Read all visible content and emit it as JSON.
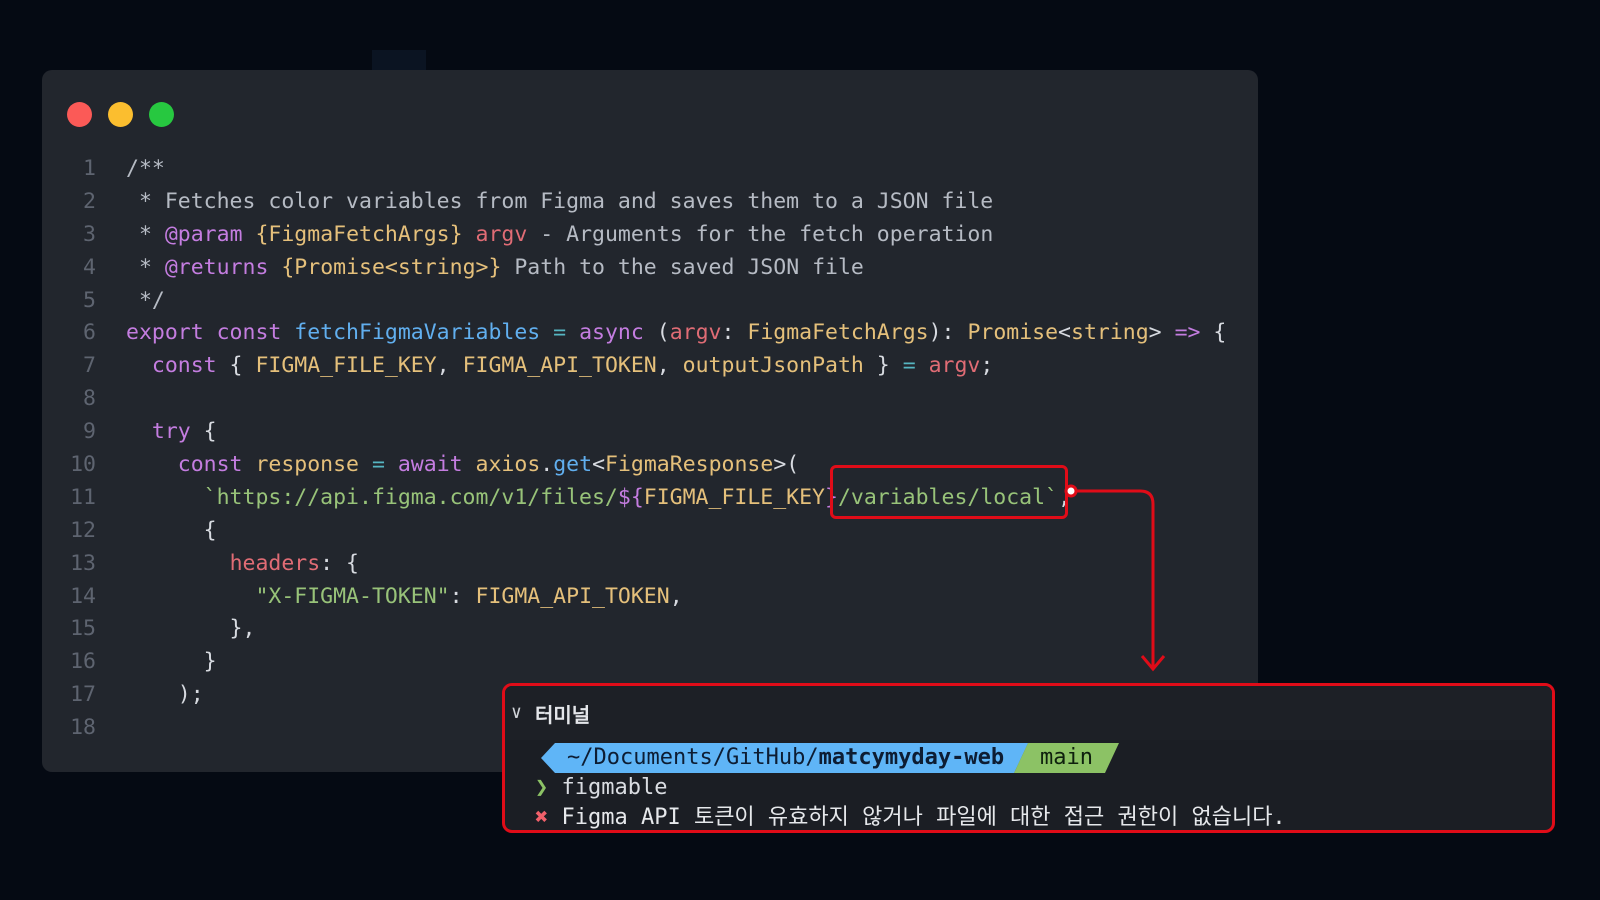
{
  "window": {
    "dots": [
      {
        "name": "close-dot",
        "color": "#fb5a57"
      },
      {
        "name": "minimize-dot",
        "color": "#fbbe2f"
      },
      {
        "name": "maximize-dot",
        "color": "#27c840"
      }
    ]
  },
  "colors": {
    "comment": "#b6bbc4",
    "keyword": "#c47de0",
    "function": "#61afef",
    "type": "#e5c07b",
    "variable": "#e06c75",
    "string": "#98c379",
    "plain": "#d7dae0",
    "operator": "#56b6c2",
    "highlight": "#e00c18"
  },
  "code": {
    "lines": [
      {
        "n": "1",
        "tokens": [
          {
            "t": "/**",
            "c": "comment"
          }
        ]
      },
      {
        "n": "2",
        "tokens": [
          {
            "t": " * Fetches color variables from Figma and saves them to a JSON file",
            "c": "comment"
          }
        ]
      },
      {
        "n": "3",
        "tokens": [
          {
            "t": " * ",
            "c": "comment"
          },
          {
            "t": "@param",
            "c": "keyword"
          },
          {
            "t": " ",
            "c": "comment"
          },
          {
            "t": "{FigmaFetchArgs}",
            "c": "type"
          },
          {
            "t": " ",
            "c": "comment"
          },
          {
            "t": "argv",
            "c": "variable"
          },
          {
            "t": " - Arguments for the fetch operation",
            "c": "comment"
          }
        ]
      },
      {
        "n": "4",
        "tokens": [
          {
            "t": " * ",
            "c": "comment"
          },
          {
            "t": "@returns",
            "c": "keyword"
          },
          {
            "t": " ",
            "c": "comment"
          },
          {
            "t": "{Promise<string>}",
            "c": "type"
          },
          {
            "t": " Path to the saved JSON file",
            "c": "comment"
          }
        ]
      },
      {
        "n": "5",
        "tokens": [
          {
            "t": " */",
            "c": "comment"
          }
        ]
      },
      {
        "n": "6",
        "tokens": [
          {
            "t": "export const ",
            "c": "keyword"
          },
          {
            "t": "fetchFigmaVariables",
            "c": "function"
          },
          {
            "t": " = ",
            "c": "operator"
          },
          {
            "t": "async",
            "c": "keyword"
          },
          {
            "t": " (",
            "c": "plain"
          },
          {
            "t": "argv",
            "c": "variable"
          },
          {
            "t": ": ",
            "c": "plain"
          },
          {
            "t": "FigmaFetchArgs",
            "c": "type"
          },
          {
            "t": "): ",
            "c": "plain"
          },
          {
            "t": "Promise",
            "c": "type"
          },
          {
            "t": "<",
            "c": "plain"
          },
          {
            "t": "string",
            "c": "type"
          },
          {
            "t": "> ",
            "c": "plain"
          },
          {
            "t": "=>",
            "c": "keyword"
          },
          {
            "t": " {",
            "c": "plain"
          }
        ]
      },
      {
        "n": "7",
        "tokens": [
          {
            "t": "  const",
            "c": "keyword"
          },
          {
            "t": " { ",
            "c": "plain"
          },
          {
            "t": "FIGMA_FILE_KEY",
            "c": "type"
          },
          {
            "t": ", ",
            "c": "plain"
          },
          {
            "t": "FIGMA_API_TOKEN",
            "c": "type"
          },
          {
            "t": ", ",
            "c": "plain"
          },
          {
            "t": "outputJsonPath",
            "c": "type"
          },
          {
            "t": " } ",
            "c": "plain"
          },
          {
            "t": "=",
            "c": "operator"
          },
          {
            "t": " ",
            "c": "plain"
          },
          {
            "t": "argv",
            "c": "variable"
          },
          {
            "t": ";",
            "c": "plain"
          }
        ]
      },
      {
        "n": "8",
        "tokens": []
      },
      {
        "n": "9",
        "tokens": [
          {
            "t": "  try",
            "c": "keyword"
          },
          {
            "t": " {",
            "c": "plain"
          }
        ]
      },
      {
        "n": "10",
        "tokens": [
          {
            "t": "    const",
            "c": "keyword"
          },
          {
            "t": " ",
            "c": "plain"
          },
          {
            "t": "response",
            "c": "type"
          },
          {
            "t": " = ",
            "c": "operator"
          },
          {
            "t": "await",
            "c": "keyword"
          },
          {
            "t": " ",
            "c": "plain"
          },
          {
            "t": "axios",
            "c": "type"
          },
          {
            "t": ".",
            "c": "plain"
          },
          {
            "t": "get",
            "c": "function"
          },
          {
            "t": "<",
            "c": "plain"
          },
          {
            "t": "FigmaResponse",
            "c": "type"
          },
          {
            "t": ">(",
            "c": "plain"
          }
        ]
      },
      {
        "n": "11",
        "tokens": [
          {
            "t": "      `https://api.figma.com/v1/files/",
            "c": "string"
          },
          {
            "t": "${",
            "c": "keyword"
          },
          {
            "t": "FIGMA_FILE_KEY",
            "c": "type"
          },
          {
            "t": "}",
            "c": "keyword"
          },
          {
            "t": "/variables/local`",
            "c": "string"
          },
          {
            "t": ",",
            "c": "plain"
          }
        ]
      },
      {
        "n": "12",
        "tokens": [
          {
            "t": "      {",
            "c": "plain"
          }
        ]
      },
      {
        "n": "13",
        "tokens": [
          {
            "t": "        ",
            "c": "plain"
          },
          {
            "t": "headers",
            "c": "variable"
          },
          {
            "t": ": {",
            "c": "plain"
          }
        ]
      },
      {
        "n": "14",
        "tokens": [
          {
            "t": "          ",
            "c": "plain"
          },
          {
            "t": "\"X-FIGMA-TOKEN\"",
            "c": "string"
          },
          {
            "t": ": ",
            "c": "plain"
          },
          {
            "t": "FIGMA_API_TOKEN",
            "c": "type"
          },
          {
            "t": ",",
            "c": "plain"
          }
        ]
      },
      {
        "n": "15",
        "tokens": [
          {
            "t": "        },",
            "c": "plain"
          }
        ]
      },
      {
        "n": "16",
        "tokens": [
          {
            "t": "      }",
            "c": "plain"
          }
        ]
      },
      {
        "n": "17",
        "tokens": [
          {
            "t": "    );",
            "c": "plain"
          }
        ]
      },
      {
        "n": "18",
        "tokens": []
      }
    ]
  },
  "terminal": {
    "title": "터미널",
    "chevron": "∨",
    "path_prefix": "~/Documents/GitHub/",
    "path_repo": "matcymyday-web",
    "branch": "main",
    "prompt_symbol": "❯",
    "command": "figmable",
    "error_symbol": "✖",
    "error_message": "Figma API 토큰이 유효하지 않거나 파일에 대한 접근 권한이 없습니다."
  }
}
